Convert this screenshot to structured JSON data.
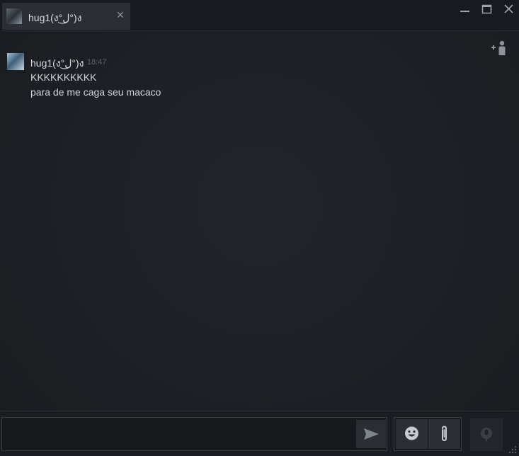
{
  "tab": {
    "title": "hug1(ง°ل͜°)ง",
    "close_glyph": "✕"
  },
  "window_controls": {
    "minimize_icon": "minimize-icon",
    "maximize_icon": "maximize-icon",
    "close_icon": "close-icon"
  },
  "messages": [
    {
      "author": "hug1(ง°ل͜°)ง",
      "time": "18:47",
      "lines": [
        "KKKKKKKKKK",
        "para de me caga seu macaco"
      ]
    }
  ],
  "composer": {
    "input_value": "",
    "send_icon": "send-icon",
    "emoji_icon": "emoji-icon",
    "attach_icon": "paperclip-icon",
    "voice_icon": "microphone-icon"
  },
  "colors": {
    "background": "#1e2025",
    "titlebar": "#171a21",
    "tab_active": "#2b2e35",
    "text_primary": "#d0d4d9",
    "text_muted": "#5f646b"
  }
}
